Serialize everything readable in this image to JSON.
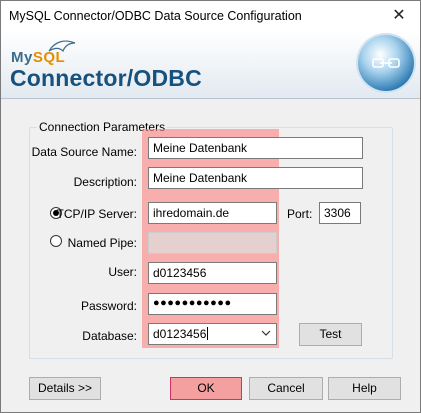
{
  "window": {
    "title": "MySQL Connector/ODBC Data Source Configuration",
    "close_glyph": "✕"
  },
  "banner": {
    "logo_my": "My",
    "logo_sql": "SQL",
    "product": "Connector/ODBC"
  },
  "group": {
    "legend": "Connection Parameters"
  },
  "form": {
    "dsn_label": "Data Source Name:",
    "dsn_value": "Meine Datenbank",
    "desc_label": "Description:",
    "desc_value": "Meine Datenbank",
    "tcp_label": "TCP/IP Server:",
    "tcp_value": "ihredomain.de",
    "tcp_selected": true,
    "port_label": "Port:",
    "port_value": "3306",
    "pipe_label": "Named Pipe:",
    "pipe_value": "",
    "user_label": "User:",
    "user_value": "d0123456",
    "password_label": "Password:",
    "password_value": "●●●●●●●●●●●",
    "database_label": "Database:",
    "database_value": "d0123456"
  },
  "buttons": {
    "test": "Test",
    "details": "Details >>",
    "ok": "OK",
    "cancel": "Cancel",
    "help": "Help"
  },
  "colors": {
    "highlight": "#ff8282",
    "brand_blue": "#17517e",
    "brand_orange": "#e48e00"
  }
}
